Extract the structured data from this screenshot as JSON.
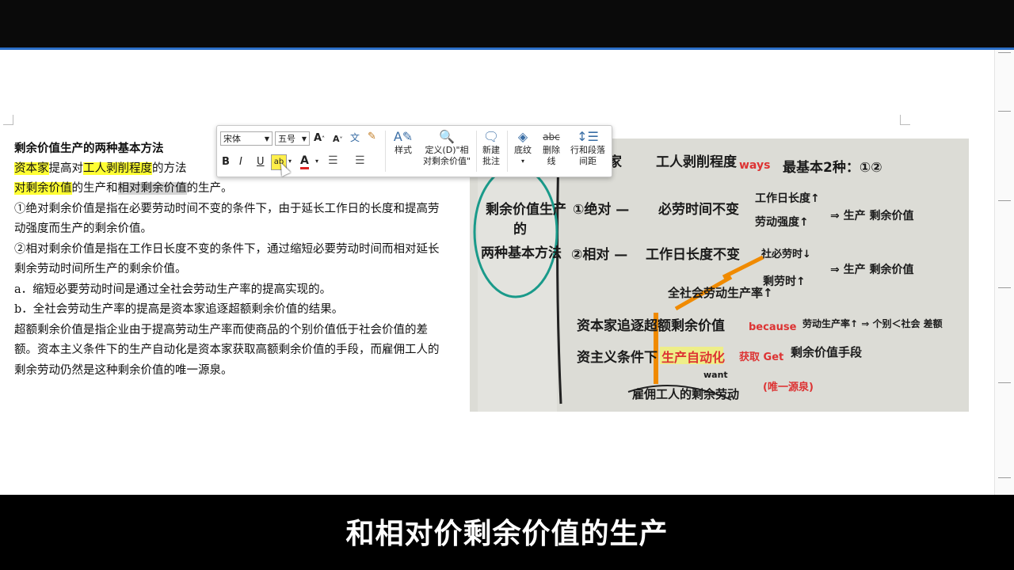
{
  "document": {
    "heading": "剩余价值生产的两种基本方法",
    "line1": {
      "hl1": "资本家",
      "t1": "提高对",
      "hl2": "工人剥削程度",
      "t2": "的方法"
    },
    "line2": {
      "hl3": "对剩余价值",
      "t3": "的生产和",
      "sel": "相对剩余价值",
      "t4": "的生产。"
    },
    "para1": "①绝对剩余价值是指在必要劳动时间不变的条件下，由于延长工作日的长度和提高劳动强度而生产的剩余价值。",
    "para2": "②相对剩余价值是指在工作日长度不变的条件下，通过缩短必要劳动时间而相对延长剩余劳动时间所生产的剩余价值。",
    "para_a": "a．缩短必要劳动时间是通过全社会劳动生产率的提高实现的。",
    "para_b": "b．全社会劳动生产率的提高是资本家追逐超额剩余价值的结果。",
    "para3": "超额剩余价值是指企业由于提高劳动生产率而使商品的个别价值低于社会价值的差额。资本主义条件下的生产自动化是资本家获取高额剩余价值的手段，而雇佣工人的剩余劳动仍然是这种剩余价值的唯一源泉。"
  },
  "toolbar": {
    "font_name": "宋体",
    "font_size": "五号",
    "bold": "B",
    "italic": "I",
    "underline": "U",
    "styles_label": "样式",
    "define_label_1": "定义(D)\"相",
    "define_label_2": "对剩余价值\"",
    "new_comment_1": "新建",
    "new_comment_2": "批注",
    "shading_label": "底纹",
    "strike_label_1": "删除",
    "strike_label_2": "线",
    "spacing_label_1": "行和段落",
    "spacing_label_2": "间距"
  },
  "notes_photo": {
    "left_title": [
      "剩余价值生产",
      "的",
      "两种基本方法"
    ],
    "row0": [
      "家",
      "工人剥削程度",
      "ways",
      "最基本2种：①②"
    ],
    "row1": [
      "①绝对 —",
      "必劳时间不变",
      "工作日长度↑",
      "劳动强度↑",
      "⇒ 生产 剩余价值"
    ],
    "row2": [
      "②相对 —",
      "工作日长度不变",
      "社必劳时↓",
      "剩劳时↑",
      "⇒ 生产 剩余价值"
    ],
    "row3": [
      "全社会劳动生产率↑"
    ],
    "row4": [
      "资本家追逐超额剩余价值",
      "because",
      "劳动生产率↑ ⇒ 个别＜社会 差额"
    ],
    "row5": [
      "资主义条件下",
      "生产自动化",
      "获取 Get",
      "剩余价值手段"
    ],
    "row6": [
      "雇佣工人的剩余劳动",
      "(唯一源泉)",
      "want"
    ]
  },
  "subtitle": "和相对价剩余价值的生产",
  "colors": {
    "highlight": "#ffff33",
    "accent": "#2b6fc7",
    "red_ink": "#d33333",
    "orange_ink": "#f08a00"
  }
}
